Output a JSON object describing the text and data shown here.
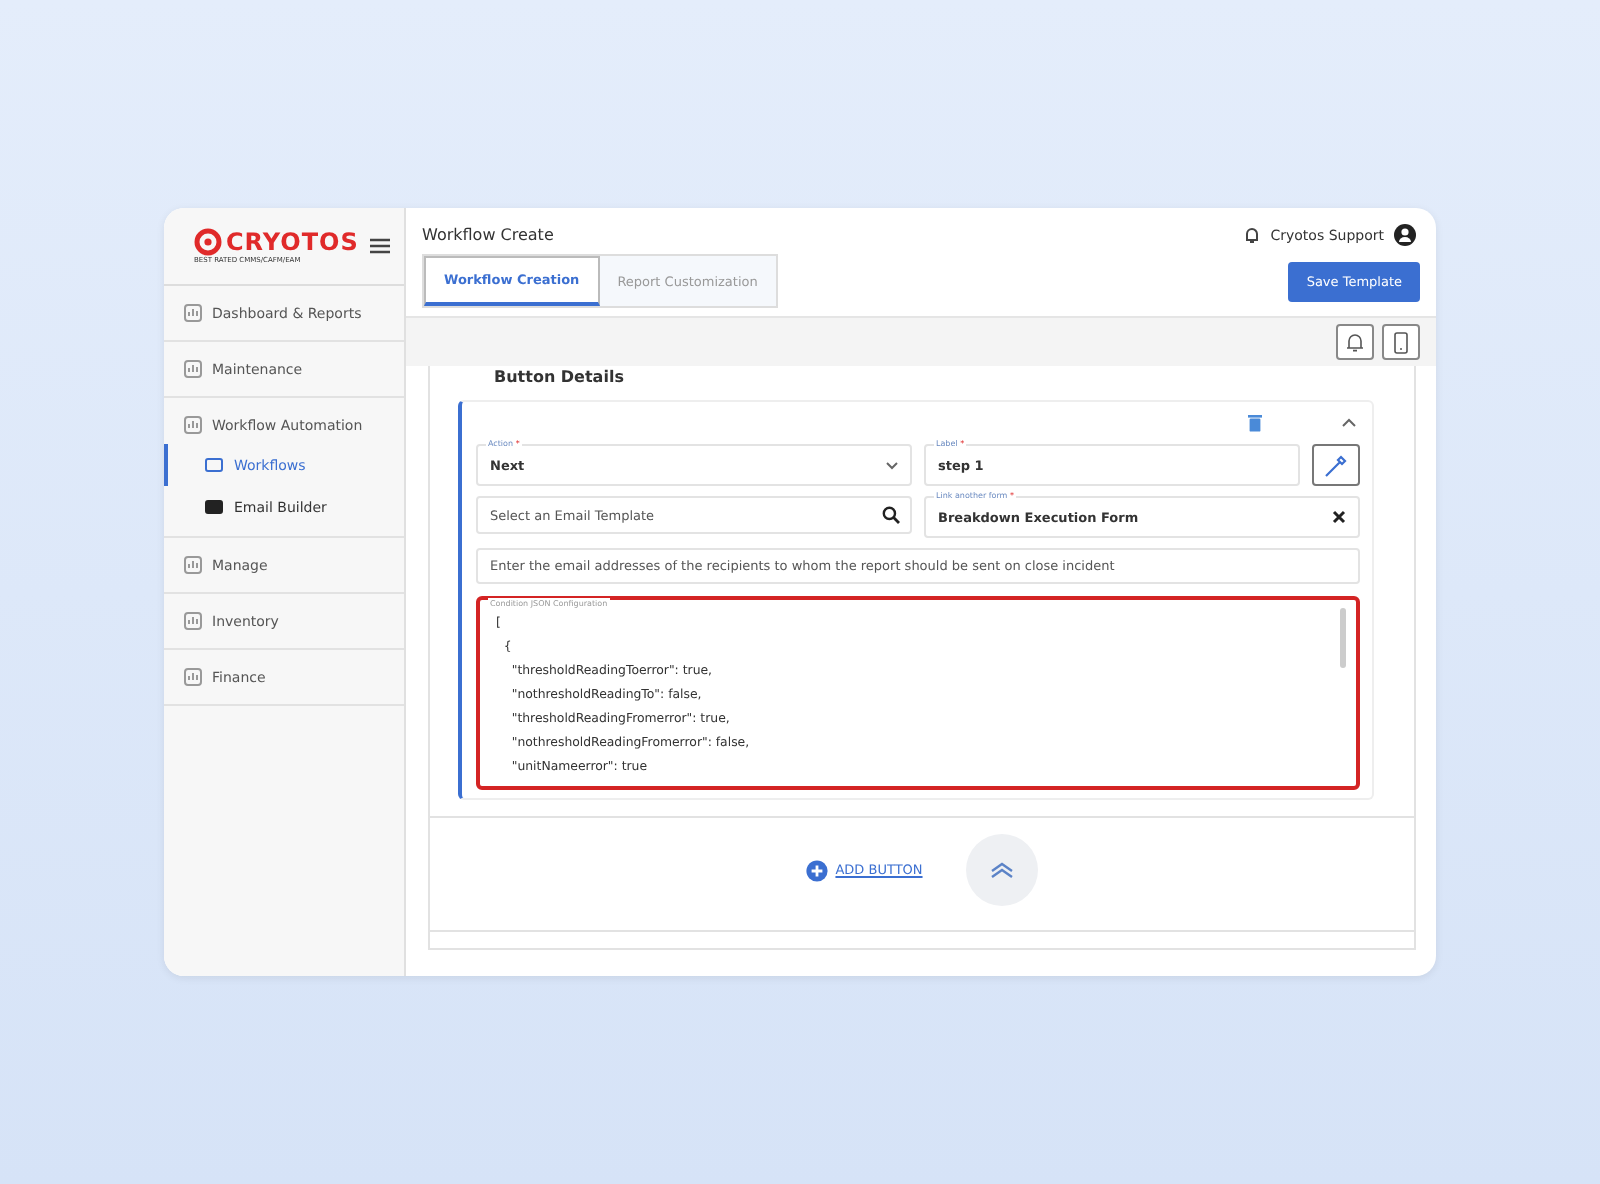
{
  "logo": {
    "name": "CRYOTOS",
    "tagline": "BEST RATED CMMS/CAFM/EAM"
  },
  "sidebar": {
    "items": [
      {
        "label": "Dashboard & Reports",
        "kind": "section",
        "selected": false
      },
      {
        "label": "Maintenance",
        "kind": "section",
        "selected": false
      },
      {
        "label": "Workflow Automation",
        "kind": "section",
        "selected": false,
        "children": [
          {
            "label": "Workflows",
            "kind": "sub",
            "selected": true
          },
          {
            "label": "Email Builder",
            "kind": "sub",
            "selected": false
          }
        ]
      },
      {
        "label": "Manage",
        "kind": "section",
        "selected": false
      },
      {
        "label": "Inventory",
        "kind": "section",
        "selected": false
      },
      {
        "label": "Finance",
        "kind": "section",
        "selected": false
      }
    ]
  },
  "header": {
    "title": "Workflow Create",
    "user": "Cryotos Support"
  },
  "tabs": [
    {
      "label": "Workflow Creation",
      "selected": true
    },
    {
      "label": "Report Customization",
      "selected": false
    }
  ],
  "save_button": "Save Template",
  "section_title": "Button Details",
  "form": {
    "action": {
      "label": "Action",
      "required_mark": "*",
      "value": "Next"
    },
    "label_field": {
      "label": "Label",
      "required_mark": "*",
      "value": "step 1"
    },
    "email_template": {
      "placeholder": "Select an Email Template"
    },
    "link_form": {
      "label": "Link another form",
      "required_mark": "*",
      "value": "Breakdown Execution Form"
    },
    "recipients": {
      "placeholder": "Enter the email addresses of the recipients to whom the report should be sent on close incident"
    },
    "condition": {
      "label": "Condition JSON Configuration",
      "lines": [
        "[",
        "  {",
        "    \"thresholdReadingToerror\": true,",
        "    \"nothresholdReadingTo\": false,",
        "    \"thresholdReadingFromerror\": true,",
        "    \"nothresholdReadingFromerror\": false,",
        "    \"unitNameerror\": true"
      ]
    }
  },
  "add_button": "ADD BUTTON"
}
